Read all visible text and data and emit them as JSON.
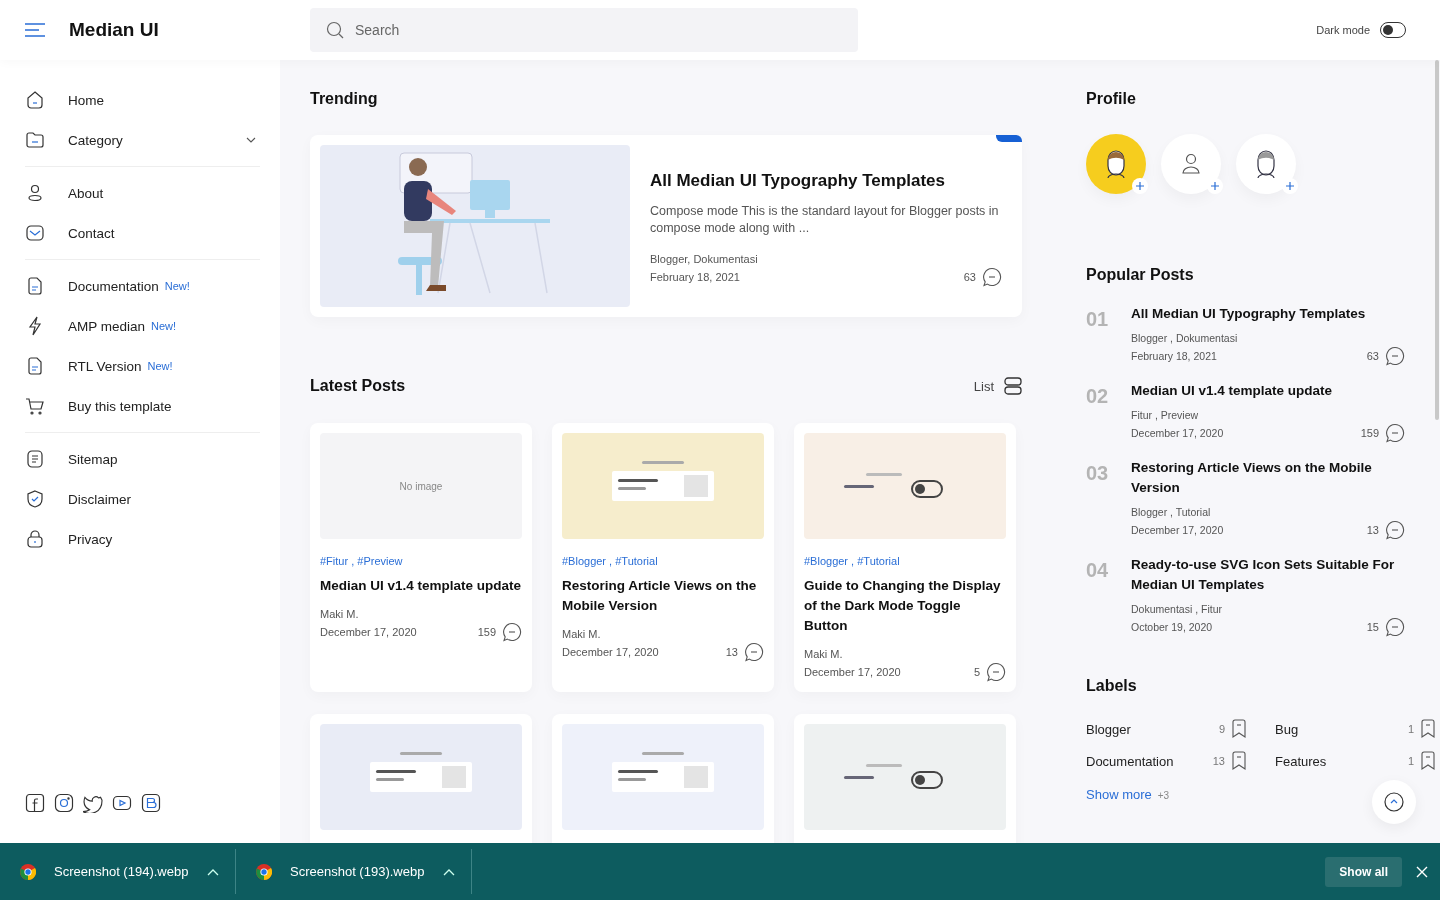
{
  "header": {
    "brand": "Median UI",
    "search": {
      "placeholder": "Search"
    },
    "dark_mode": {
      "label": "Dark mode",
      "on": false
    }
  },
  "sidebar": {
    "groups": [
      [
        {
          "label": "Home",
          "kind": "home"
        },
        {
          "label": "Category",
          "kind": "folder",
          "expanded": false
        }
      ],
      [
        {
          "label": "About",
          "kind": "user"
        },
        {
          "label": "Contact",
          "kind": "mail"
        }
      ],
      [
        {
          "label": "Documentation",
          "kind": "doc",
          "badge": "New!"
        },
        {
          "label": "AMP median",
          "kind": "bolt",
          "badge": "New!"
        },
        {
          "label": "RTL Version",
          "kind": "doc",
          "badge": "New!"
        },
        {
          "label": "Buy this template",
          "kind": "cart"
        }
      ],
      [
        {
          "label": "Sitemap",
          "kind": "list"
        },
        {
          "label": "Disclaimer",
          "kind": "shield"
        },
        {
          "label": "Privacy",
          "kind": "lock"
        }
      ]
    ],
    "social": [
      {
        "kind": "facebook"
      },
      {
        "kind": "instagram"
      },
      {
        "kind": "twitter"
      },
      {
        "kind": "youtube"
      },
      {
        "kind": "blogger"
      }
    ]
  },
  "trending": {
    "title": "Trending",
    "post": {
      "title": "All Median UI Typography Templates",
      "snippet": "Compose mode This is the standard layout for Blogger posts in compose mode along with ...",
      "labels": "Blogger, Dokumentasi",
      "date": "February 18, 2021",
      "comments": "63"
    }
  },
  "latest": {
    "title": "Latest Posts",
    "view": "List",
    "posts": [
      {
        "thumb": {
          "kind": "empty",
          "text": "No image"
        },
        "tags": "#Fitur , #Preview",
        "title": "Median UI v1.4 template update",
        "author": "Maki M.",
        "date": "December 17, 2020",
        "comments": "159"
      },
      {
        "thumb": {
          "kind": "picture"
        },
        "tags": "#Blogger , #Tutorial",
        "title": "Restoring Article Views on the Mobile Version",
        "author": "Maki M.",
        "date": "December 17, 2020",
        "comments": "13"
      },
      {
        "thumb": {
          "kind": "picture"
        },
        "tags": "#Blogger , #Tutorial",
        "title": "Guide to Changing the Display of the Dark Mode Toggle Button",
        "author": "Maki M.",
        "date": "December 17, 2020",
        "comments": "5"
      },
      {
        "thumb": {
          "kind": "picture"
        }
      },
      {
        "thumb": {
          "kind": "picture"
        }
      },
      {
        "thumb": {
          "kind": "picture"
        }
      }
    ]
  },
  "profile": {
    "title": "Profile",
    "avatars": [
      {
        "kind": "filled"
      },
      {
        "kind": "outline"
      },
      {
        "kind": "plain"
      }
    ]
  },
  "popular": {
    "title": "Popular Posts",
    "posts": [
      {
        "rank": "01",
        "title": "All Median UI Typography Templates",
        "labels": "Blogger , Dokumentasi",
        "date": "February 18, 2021",
        "comments": "63"
      },
      {
        "rank": "02",
        "title": "Median UI v1.4 template update",
        "labels": "Fitur , Preview",
        "date": "December 17, 2020",
        "comments": "159"
      },
      {
        "rank": "03",
        "title": "Restoring Article Views on the Mobile Version",
        "labels": "Blogger , Tutorial",
        "date": "December 17, 2020",
        "comments": "13"
      },
      {
        "rank": "04",
        "title": "Ready-to-use SVG Icon Sets Suitable For Median UI Templates",
        "labels": "Dokumentasi , Fitur",
        "date": "October 19, 2020",
        "comments": "15"
      }
    ]
  },
  "labels": {
    "title": "Labels",
    "items": [
      {
        "name": "Blogger",
        "count": "9"
      },
      {
        "name": "Bug",
        "count": "1"
      },
      {
        "name": "Documentation",
        "count": "13"
      },
      {
        "name": "Features",
        "count": "1"
      }
    ],
    "show_more": "Show more",
    "more_count": "+3"
  },
  "downloads": {
    "items": [
      {
        "name": "Screenshot (194).webp"
      },
      {
        "name": "Screenshot (193).webp"
      }
    ],
    "show_all": "Show all"
  }
}
